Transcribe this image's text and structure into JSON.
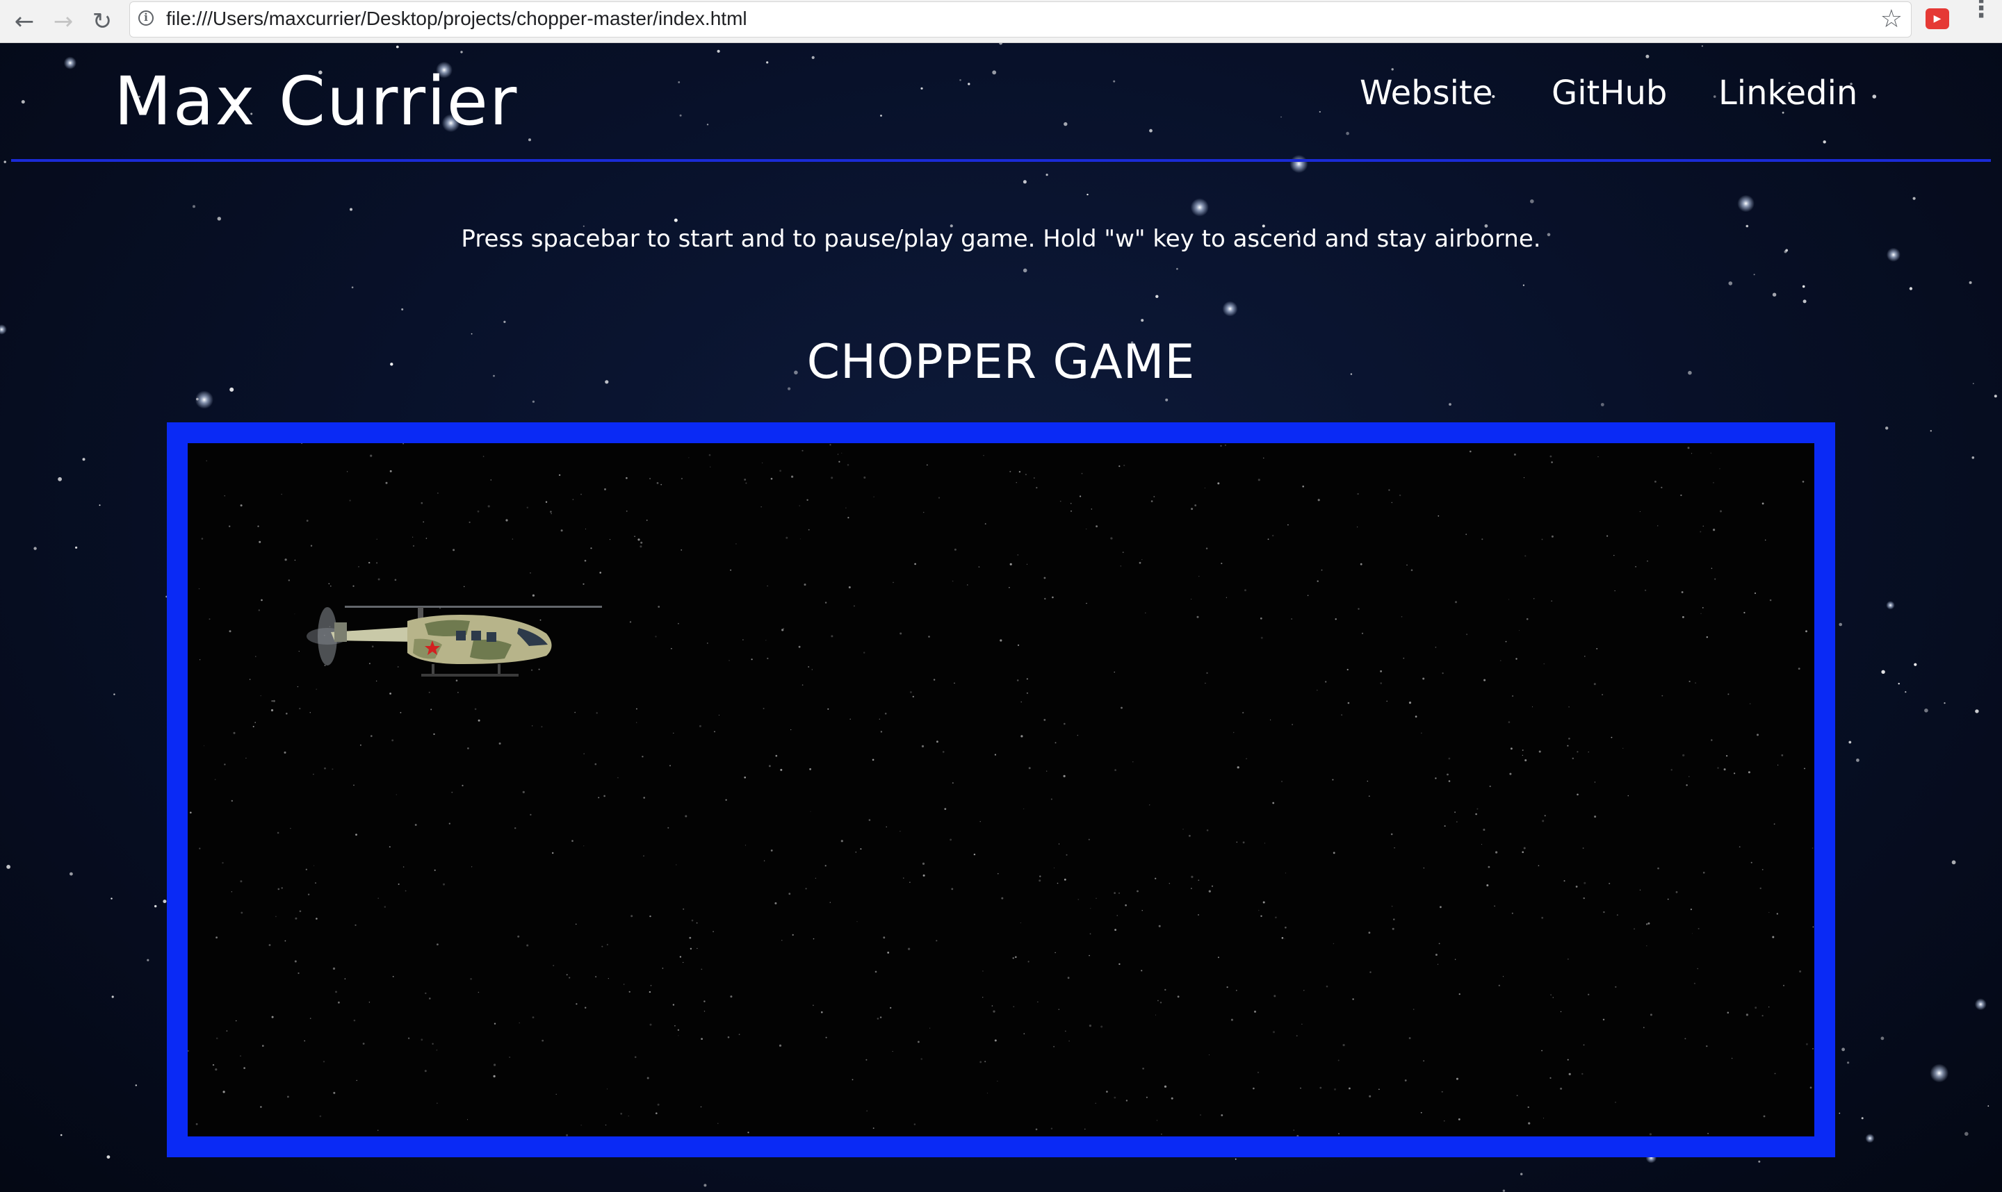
{
  "browser": {
    "url": "file:///Users/maxcurrier/Desktop/projects/chopper-master/index.html",
    "back_icon": "arrow-left-icon",
    "forward_icon": "arrow-right-icon",
    "reload_icon": "reload-icon",
    "info_icon": "info-icon",
    "bookmark_icon": "star-icon",
    "extension_icon": "youtube-extension-icon",
    "menu_icon": "kebab-menu-icon"
  },
  "header": {
    "title": "Max Currier",
    "nav": [
      {
        "label": "Website"
      },
      {
        "label": "GitHub"
      },
      {
        "label": "Linkedin"
      }
    ],
    "rule_color": "#1a2bd6"
  },
  "main": {
    "instructions": "Press spacebar to start and to pause/play game. Hold \"w\" key to ascend and stay airborne.",
    "game_title": "CHOPPER GAME",
    "frame_color": "#0a2af5",
    "canvas_color": "#030303",
    "sprite": "helicopter-sprite"
  }
}
